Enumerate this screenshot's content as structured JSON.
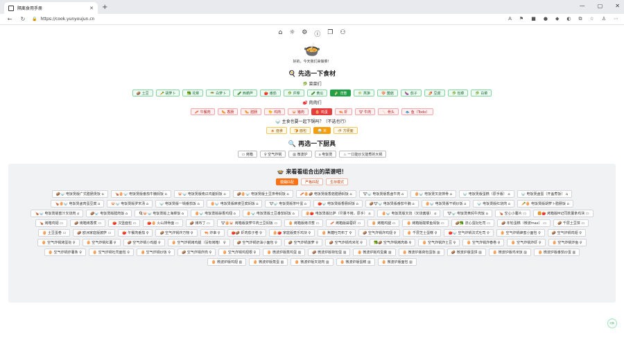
{
  "browser": {
    "tab_title": "隔离食用手册",
    "url": "https://cook.yunyoujun.cn",
    "new_tab": "+",
    "win_controls": [
      "—",
      "▢",
      "✕"
    ]
  },
  "page": {
    "top_icons": [
      "⌂",
      "☼",
      "⚙",
      "ⓘ",
      "❐",
      "⚇"
    ],
    "pot_icon": "🍲",
    "greeting": "好的，今天我们来做菜！",
    "ingredients_title": "🍳 先选一下食材",
    "veg_title": "🥬 菜菜们",
    "veg": [
      {
        "label": "🥔 土豆",
        "on": false
      },
      {
        "label": "🥕 胡萝卜",
        "on": false
      },
      {
        "label": "🥦 花菜",
        "on": false
      },
      {
        "label": "🥗 白萝卜",
        "on": false
      },
      {
        "label": "🥒 西葫芦",
        "on": false
      },
      {
        "label": "🍅 番茄",
        "on": false
      },
      {
        "label": "🥬 芹菜",
        "on": false
      },
      {
        "label": "🥒 黄瓜",
        "on": false
      },
      {
        "label": "🥬 洋葱",
        "on": true
      },
      {
        "label": "🎋 莴笋",
        "on": false
      },
      {
        "label": "🍄 菌菇",
        "on": false
      },
      {
        "label": "🍆 茄子",
        "on": false
      },
      {
        "label": "🍠 豆腐",
        "on": false
      },
      {
        "label": "🥬 包菜",
        "on": false
      },
      {
        "label": "🥬 白菜",
        "on": false
      }
    ],
    "meat_title": "🥩 肉肉们",
    "meat": [
      {
        "label": "🥓 午餐肉",
        "on": false
      },
      {
        "label": "🌭 香肠",
        "on": false
      },
      {
        "label": "🌭 腊肠",
        "on": false
      },
      {
        "label": "🐤 鸡肉",
        "on": false
      },
      {
        "label": "🐷 猪肉",
        "on": false
      },
      {
        "label": "🥚 鸡蛋",
        "on": true
      },
      {
        "label": "🦐 虾",
        "on": false
      },
      {
        "label": "🐮 牛肉",
        "on": false
      },
      {
        "label": "🦴 骨头",
        "on": false
      },
      {
        "label": "🐟 鱼（Todo）",
        "on": false
      }
    ],
    "staple_title": "🍚 主食也要一起下锅吗？（不选也行）",
    "staple": [
      {
        "label": "🍝 面食",
        "on": false
      },
      {
        "label": "🍞 面包",
        "on": false
      },
      {
        "label": "🍚 米",
        "on": true
      },
      {
        "label": "🍜 方便面",
        "on": false
      }
    ],
    "tools_title": "🔍 再选一下厨具",
    "tools": [
      "▭ 烤箱",
      "♀ 空气炸锅",
      "▥ 微波炉",
      "⌂ 电饭煲",
      "♨ 一口能炒又能煮的大锅"
    ],
    "result_title": "🍲 来看看组合出的菜谱吧！",
    "modes": [
      {
        "label": "模糊匹配",
        "on": true
      },
      {
        "label": "严格匹配",
        "on": false
      },
      {
        "label": "生存模式",
        "on": false
      }
    ],
    "recipes": [
      "🥔🍚 电饭煲版广式腊肠煲饭 ⌂",
      "🍗🥚🍚 电饭煲版番茄牛腩焖饭 ⌂",
      "🐷🍚 电饭煲版南瓜鸡腿焖饭 ⌂",
      "🥔🥚🍚 电饭煲版土豆排骨焖饭 ⌂",
      "🥓🥚🥔 电饭煲版香菇腊肠焖饭 ⌂",
      "🐮🍚 电饭煲版香卤牛肉 ⌂",
      "🥚🍚 电饭煲叉烧排骨 ⌂",
      "🍚 电饭煲版蛋糕（原手版） ⌂",
      "🍚 电饭煲卤蛋（开盖煮饭） ⌂",
      "🍗🥚🍚 电饭煲卤肉蛋豆腐 ⌂",
      "🐷🍚 电饭煲版罗宋汤 ⌂",
      "🍚 电饭煲版一锅番茄饭 ⌂",
      "🥚🍚 电饭煲版麻婆豆腐焖饭 ⌂",
      "🐮🍚 电饭煲版茶叶蛋 ⌂",
      "🍅🍚 电饭煲版香肠焖饭 ⌂",
      "🥔🐮🍚 电饭煲版番茄牛腩 ⌂",
      "🥚🍚 电饭煲版干锅炒饭 ⌂",
      "🍚 电饭煲版红烧肉 ⌂",
      "🥕🥚 电饭煲版胡萝卜腊肠饭 ⌂",
      "🍗🍚 电饭煲版蜜汁叉烧肉 ⌂",
      "🥔🍚 电饭煲版腊肉饭 ⌂",
      "🍳🐷🍚 电饭煲版上海菜饭 ⌂",
      "🥚🍚 电饭煲版蒜香鸡翅 ⌂",
      "🥚🍚 电饭煲版土豆番茄焖饭 ⌂",
      "🥚🍅 电饭煲版比萨（尽量不烤，原手） ⌂",
      "🥚🍚 电饭煲版叉烧（叉烧酱版） ⌂",
      "🐮🍚 电饭煲黄焖牛肉饭 ⌂",
      "🍗 空心小薯片 ▭",
      "🍔🍅 烤箱版M记同款薯条鸡块 ▭",
      "🍗 烤箱鸡翅 ▭",
      "🥔 烤箱烤香蕉 ▭",
      "🍅 汉堡面包 ▭",
      "🍅🥚 火山排骨面 ▭",
      "🥔 烤布丁 ▭",
      "🐮🥚🐷 烤箱版菠萝牛肉土豆焖饭 ▭",
      "🥚 烤箱版烤洋葱 ▭",
      "🥓 烤箱版蒜蓉虾 ▭",
      "🥚 烤箱鸡腿 ▭",
      "🥚 烤箱版酸菜鱼焖饭 ▭",
      "🥔🥦 流心蛋挞吐司 ▭",
      "🥔 年轮蛋糕（微波max） ▭",
      "🥔 千层土豆饼 ▭",
      "🥚 土豆蛋卷 ▭",
      "🥔 欧洲家庭版披萨 ▭",
      "🍅 午餐肉番茄 ♀",
      "🥔 空气炸锅炸万物 ♀",
      "🦐 炸串 ♀",
      "🍅🥔 虾肉茄子卷 ♀",
      "🥚🍅 家庭版麦乐鸡块 ♀",
      "🥚 焦糖吐司布丁 ♀",
      "🥔 空气炸锅炸鸡翅 ♀",
      "🥚 千层芝士蛋糕 ♀",
      "🍅🍚 空气炸锅法式吐司 ♀",
      "🥚 空气炸锅蜂蜜小面包 ♀",
      "🥔 空气炸锅鸡翅 ♀",
      "🥚 空气炸锅烤蛋挞 ♀",
      "🥚 空气炸锅红薯 ♀",
      "🥔 空气炸锅小鸡腿 ♀",
      "🥚 空气炸锅烤鸡腿（没有烤箱） ♀",
      "🥔 空气炸锅奶油小面包 ♀",
      "🥔 空气炸锅菠萝 ♀",
      "🥔 空气炸锅鸡米花 ♀",
      "🥦🥔 空气炸锅烤肉串 ♀",
      "🥚 空气炸锅炸土豆 ♀",
      "🥚 空气炸锅炸春卷 ♀",
      "🥚 空气炸锅炸虾 ♀",
      "🥚 空气炸锅炸鱼 ♀",
      "🥚 空气炸锅炸薯条 ♀",
      "🥚 空气炸锅吐司面包 ♀",
      "🥚 空气炸锅炒饭 ♀",
      "🥔 空气炸锅炸肉 ♀",
      "🥚 空气炸锅鸡翅根 ♀",
      "🥚 微波炉版蒸鸡蛋 ▥",
      "🥔 微波炉版荷包蛋 ▥",
      "🥚 微波炉版鸡蛋羹 ▥",
      "🥚 微波炉版荷包蛋饭 ▥",
      "🥔 微波炉版蛋饼 ▥",
      "🥚 微波炉版鸡米饭 ▥",
      "🥚 微波炉版番茄炒蛋 ▥",
      "🥚 微波炉版鸡翅 ▥",
      "🥚 微波炉版蒸蛋 ▥",
      "🥚 微波炉版叉烧肉 ▥",
      "🥚 微波炉版蛋糕 ▥",
      "🥚 微波炉版面包 ▥"
    ],
    "float_icon": "⇨"
  }
}
